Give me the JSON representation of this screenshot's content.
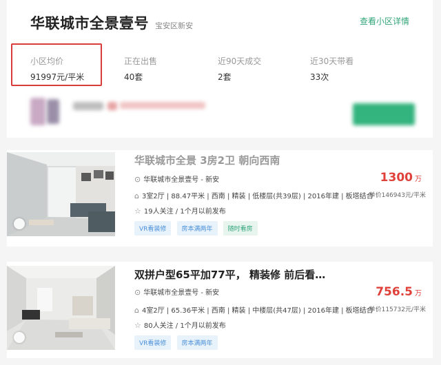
{
  "community": {
    "name": "华联城市全景壹号",
    "district": "宝安区新安",
    "detail_link": "查看小区详情",
    "stats": [
      {
        "label": "小区均价",
        "value": "91997元/平米"
      },
      {
        "label": "正在出售",
        "value": "40套"
      },
      {
        "label": "近90天成交",
        "value": "2套"
      },
      {
        "label": "近30天带看",
        "value": "33次"
      }
    ]
  },
  "listings": [
    {
      "title": "华联城市全景 3房2卫 朝向西南",
      "location": "华联城市全景壹号 - 新安",
      "specs": "3室2厅 | 88.47平米 | 西南 | 精装 | 低楼层(共39层) | 2016年建 | 板塔结合",
      "followers": "19人关注 / 1个月以前发布",
      "price": "1300",
      "price_unit": "万",
      "unit_price": "单价146943元/平米",
      "tags": [
        {
          "label": "VR看装修",
          "style": "blue"
        },
        {
          "label": "房本满两年",
          "style": "blue"
        },
        {
          "label": "随时看房",
          "style": "green"
        }
      ]
    },
    {
      "title": "双拼户型65平加77平， 精装修 前后看…",
      "location": "华联城市全景壹号 - 新安",
      "specs": "4室2厅 | 65.36平米 | 西南 | 精装 | 中楼层(共47层) | 2016年建 | 板塔结合",
      "followers": "80人关注 / 1个月以前发布",
      "price": "756.5",
      "price_unit": "万",
      "unit_price": "单价115732元/平米",
      "tags": [
        {
          "label": "VR看装修",
          "style": "blue"
        },
        {
          "label": "房本满两年",
          "style": "blue"
        }
      ]
    }
  ],
  "colors": {
    "accent_green": "#32a57a",
    "price_red": "#e0403a",
    "highlight_red": "#d93a3a"
  },
  "icons": {
    "location": "location-pin-icon",
    "house": "house-icon",
    "star": "star-icon"
  }
}
